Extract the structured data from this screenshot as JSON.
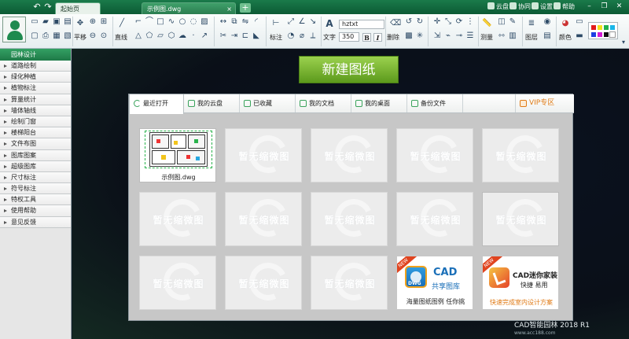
{
  "titlebar": {
    "home_tab": "起始页",
    "doc_tab": "示例图.dwg",
    "close_glyph": "×",
    "add_glyph": "+",
    "links": [
      "云盘",
      "协同",
      "设置",
      "帮助"
    ]
  },
  "ribbon": {
    "pan_label": "平移",
    "line_label": "直线",
    "dim_label": "标注",
    "text_label": "文字",
    "font_name": "hztxt",
    "font_size": "350",
    "bold": "B",
    "italic": "I",
    "delete_label": "删除",
    "measure_label": "测量",
    "layer_label": "图层",
    "color_label": "颜色"
  },
  "sidebar": {
    "header": "园林设计",
    "items": [
      "道路绘制",
      "绿化种植",
      "植物标注",
      "算量统计",
      "墙体轴线",
      "绘制门窗",
      "楼梯阳台",
      "文件布图",
      "图库图案",
      "超级图库",
      "尺寸标注",
      "符号标注",
      "特权工具",
      "使用帮助",
      "意见反馈"
    ]
  },
  "main": {
    "new_drawing": "新建图纸",
    "tabs": [
      "最近打开",
      "我的云盘",
      "已收藏",
      "我的文档",
      "我的桌面",
      "备份文件"
    ],
    "vip_tab": "VIP专区",
    "first_file": "示例图.dwg",
    "placeholder": "暂无缩微图",
    "promo_library": {
      "title": "CAD",
      "subtitle": "共享图库",
      "caption": "海量图纸图例 任你挑",
      "badge": "NEW"
    },
    "promo_decor": {
      "title": "CAD迷你家装",
      "subtitle": "快捷 易用",
      "caption": "快速完成室内设计方案",
      "badge": "NEW"
    }
  },
  "brand": {
    "name": "CAD智能园林",
    "version": "2018 R1",
    "site": "www.acc188.com"
  },
  "colors": {
    "accent": "#2a8f55",
    "vip": "#e07a14",
    "new_button": "#7cb834"
  }
}
